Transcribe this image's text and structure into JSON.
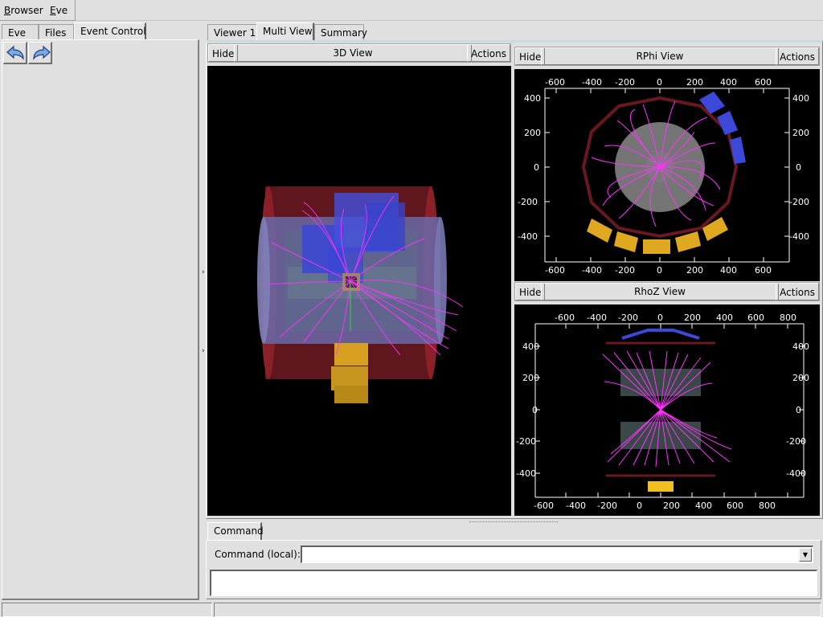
{
  "menubar": {
    "items": [
      {
        "label": "Browser",
        "underline": "B",
        "rest": "rowser"
      },
      {
        "label": "Eve",
        "underline": "E",
        "rest": "ve"
      }
    ]
  },
  "left_tabs": [
    {
      "label": "Eve",
      "active": false
    },
    {
      "label": "Files",
      "active": false
    },
    {
      "label": "Event Control",
      "active": true
    }
  ],
  "toolbar": {
    "back_icon": "undo-arrow-icon",
    "forward_icon": "redo-arrow-icon"
  },
  "right_tabs": [
    {
      "label": "Viewer 1",
      "active": false
    },
    {
      "label": "Multi View",
      "active": true
    },
    {
      "label": "Summary",
      "active": false
    }
  ],
  "views": {
    "view3d": {
      "hide": "Hide",
      "title": "3D View",
      "actions": "Actions"
    },
    "rphi": {
      "hide": "Hide",
      "title": "RPhi View",
      "actions": "Actions",
      "x_ticks": [
        "-600",
        "-400",
        "-200",
        "0",
        "200",
        "400",
        "600"
      ],
      "y_ticks": [
        "400",
        "200",
        "0",
        "-200",
        "-400"
      ]
    },
    "rhoz": {
      "hide": "Hide",
      "title": "RhoZ View",
      "actions": "Actions",
      "x_ticks": [
        "-600",
        "-400",
        "-200",
        "0",
        "200",
        "400",
        "600",
        "800"
      ],
      "y_ticks": [
        "400",
        "200",
        "0",
        "-200",
        "-400"
      ]
    }
  },
  "command": {
    "tab_label": "Command",
    "label": "Command (local):",
    "value": "",
    "output": ""
  },
  "colors": {
    "track": "#ff33ff",
    "calorimeter": "#7a1a22",
    "muon_blue": "#3b48d8",
    "muon_yellow": "#e0a820",
    "tracker_gray": "#8a8a8a"
  }
}
